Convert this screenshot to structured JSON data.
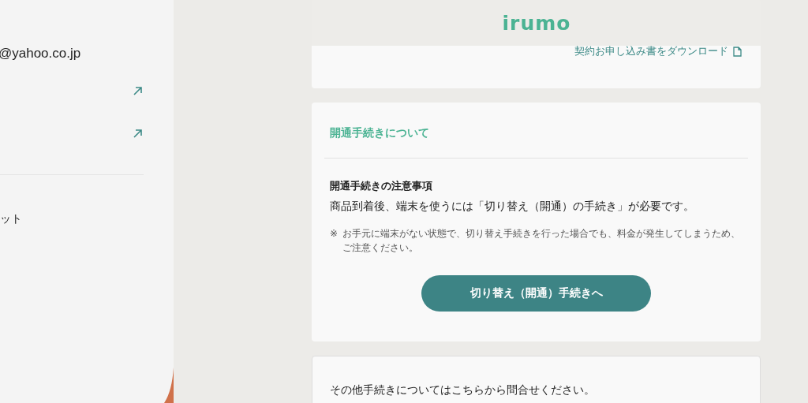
{
  "sidebar": {
    "email": "@yahoo.co.jp",
    "links": [
      {
        "kind": "external"
      },
      {
        "kind": "external"
      }
    ],
    "logout": "ット"
  },
  "header": {
    "logo": "irumo"
  },
  "contract_card": {
    "download_link": "契約お申し込み書をダウンロード"
  },
  "activation_card": {
    "title": "開通手続きについて",
    "heading": "開通手続きの注意事項",
    "body": "商品到着後、端末を使うには「切り替え（開通）の手続き」が必要です。",
    "note_mark": "※",
    "note": "お手元に端末がない状態で、切り替え手続きを行った場合でも、料金が発生してしまうため、ご注意ください。",
    "button": "切り替え（開通）手続きへ"
  },
  "other_card": {
    "text": "その他手続きについてはこちらから問合せください。"
  }
}
